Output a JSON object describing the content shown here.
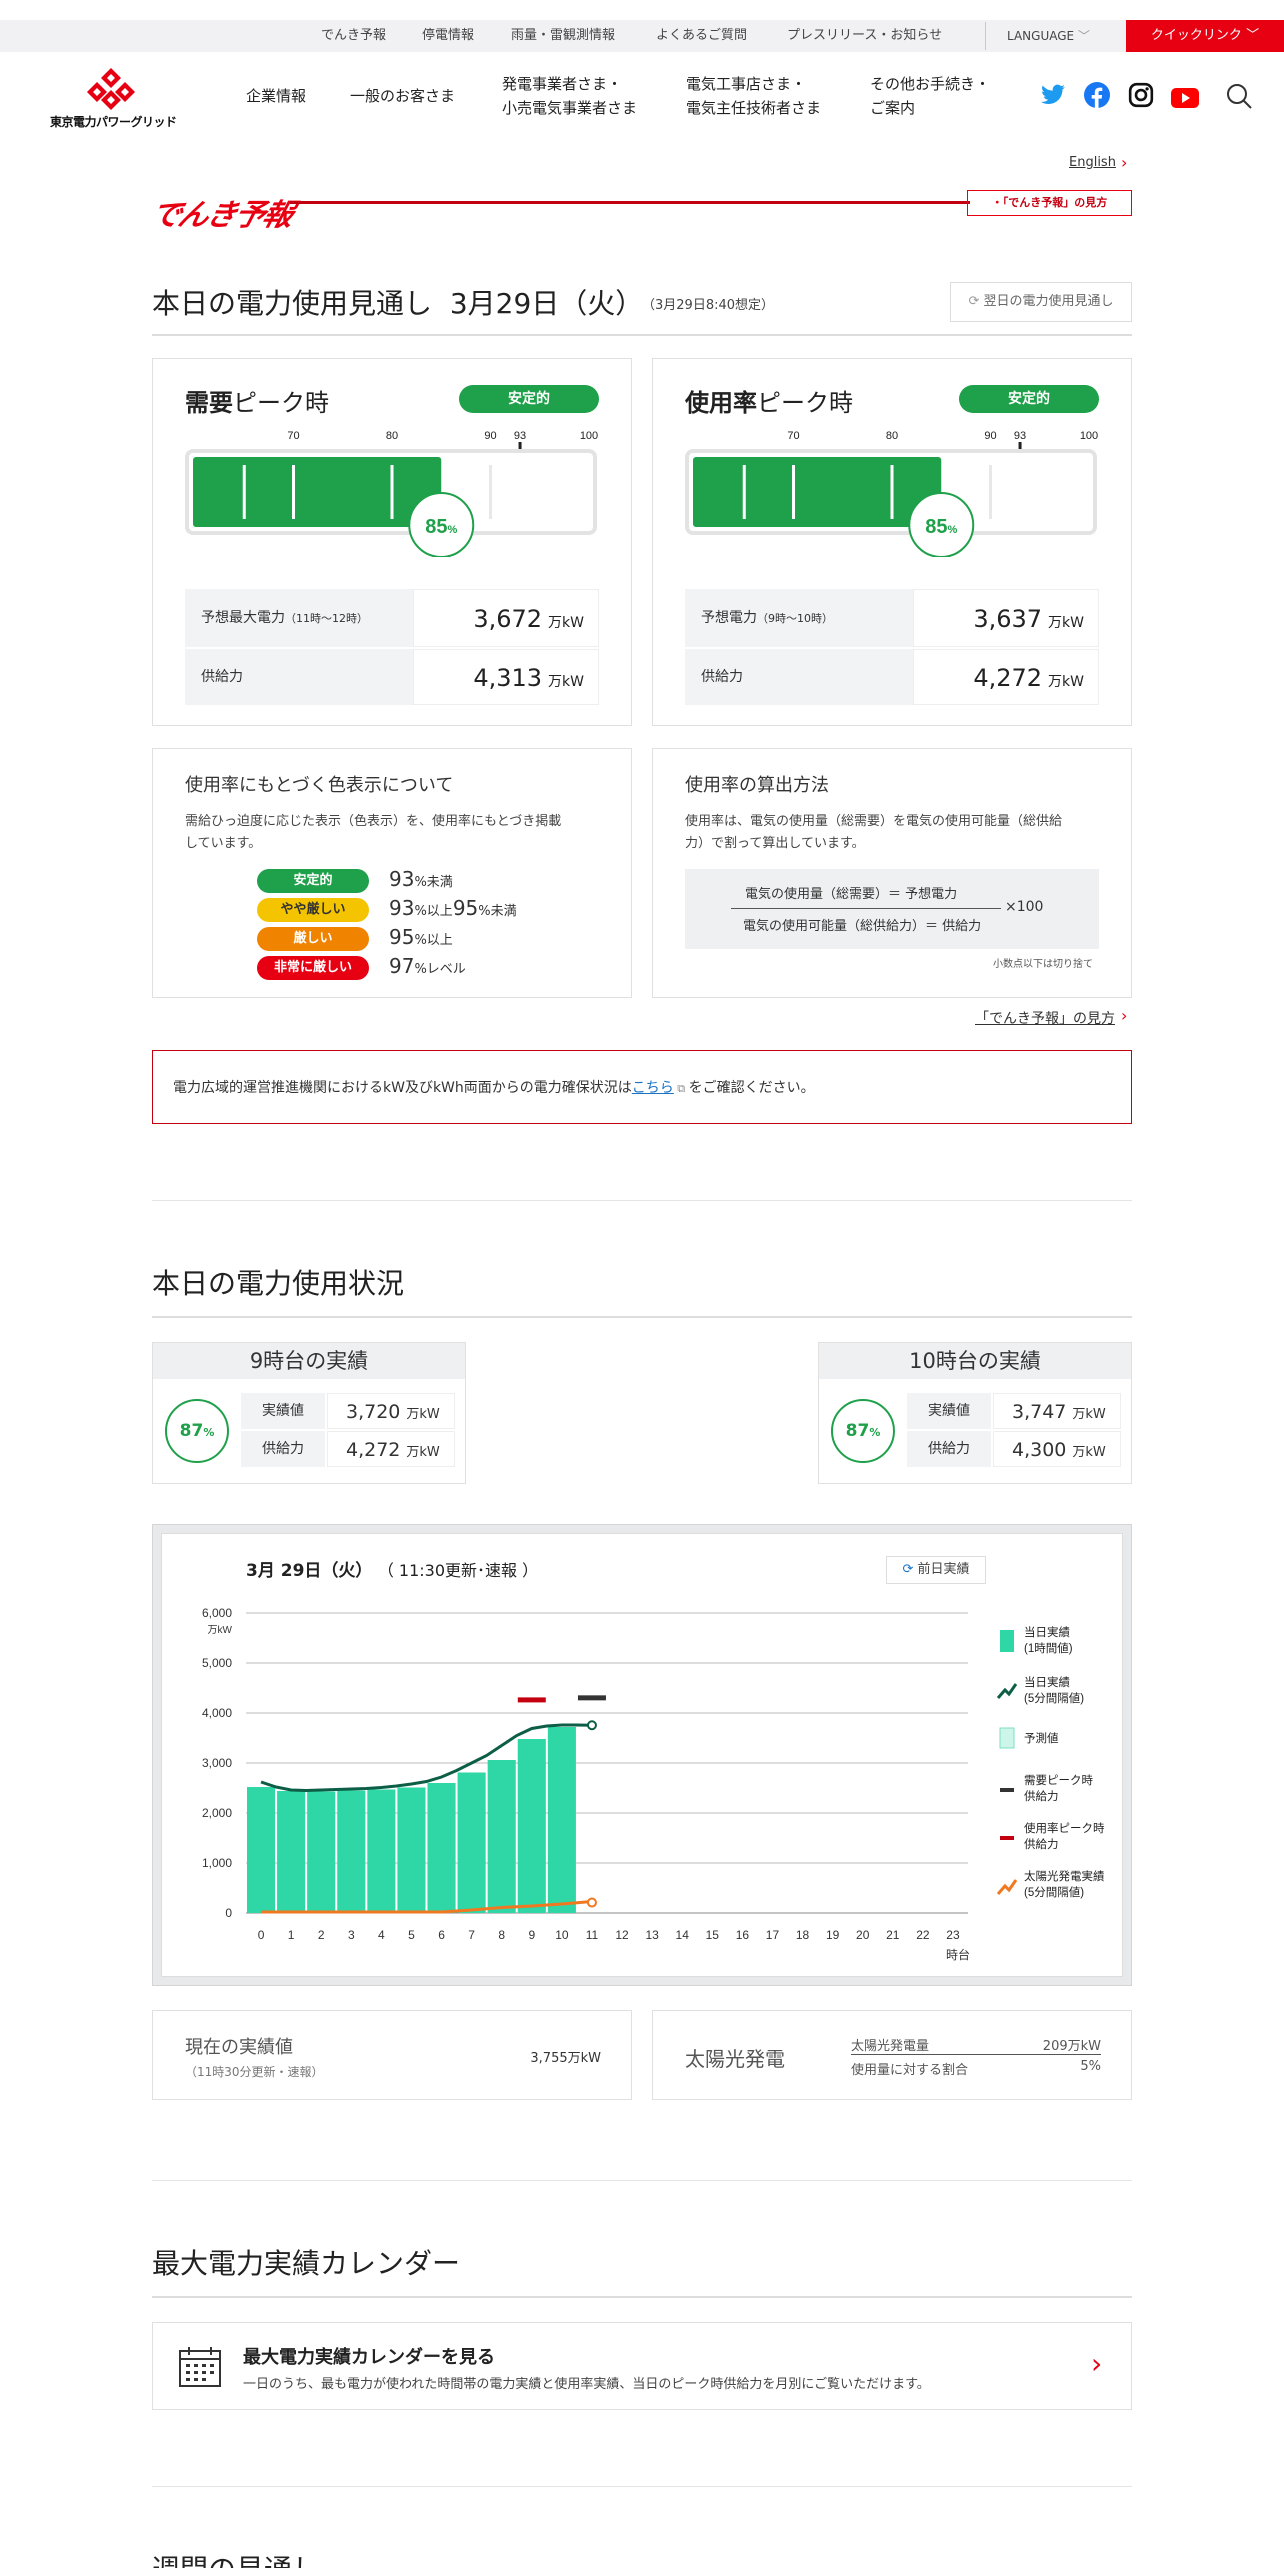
{
  "colors": {
    "brand_red": "#e60012",
    "stable_green": "#1fa04a",
    "caution_yellow": "#f5c400",
    "tight_orange": "#f08300",
    "critical_red": "#e60012",
    "actual_teal": "#2fd6a6",
    "actual_line": "#0d5e46",
    "solar_orange": "#f07820"
  },
  "util_nav": [
    "でんき予報",
    "停電情報",
    "雨量・雷観測情報",
    "よくあるご質問",
    "プレスリリース・お知らせ"
  ],
  "language_label": "LANGUAGE",
  "quicklink_label": "クイックリンク",
  "logo_text": "東京電力パワーグリッド",
  "main_nav": [
    {
      "line1": "企業情報",
      "line2": ""
    },
    {
      "line1": "一般のお客さま",
      "line2": ""
    },
    {
      "line1": "発電事業者さま・",
      "line2": "小売電気事業者さま"
    },
    {
      "line1": "電気工事店さま・",
      "line2": "電気主任技術者さま"
    },
    {
      "line1": "その他お手続き・",
      "line2": "ご案内"
    }
  ],
  "english_link": "English",
  "denki_yoho_logo": "でんき予報",
  "howto_button": "「でんき予報」の見方",
  "forecast": {
    "heading": "本日の電力使用見通し",
    "date": "3月29日（火）",
    "assumed": "（3月29日8:40想定）",
    "next_day_button": "翌日の電力使用見通し",
    "demand_card": {
      "title_bold": "需要",
      "title_rest": "ピーク時",
      "status": "安定的",
      "scale": [
        "70",
        "80",
        "90",
        "93",
        "100"
      ],
      "percent": "85",
      "percent_unit": "%",
      "level": 0.85,
      "rows": [
        {
          "label": "予想最大電力",
          "note": "（11時～12時）",
          "value": "3,672",
          "unit": "万kW"
        },
        {
          "label": "供給力",
          "note": "",
          "value": "4,313",
          "unit": "万kW"
        }
      ]
    },
    "usage_card": {
      "title_bold": "使用率",
      "title_rest": "ピーク時",
      "status": "安定的",
      "scale": [
        "70",
        "80",
        "90",
        "93",
        "100"
      ],
      "percent": "85",
      "percent_unit": "%",
      "level": 0.85,
      "rows": [
        {
          "label": "予想電力",
          "note": "（9時～10時）",
          "value": "3,637",
          "unit": "万kW"
        },
        {
          "label": "供給力",
          "note": "",
          "value": "4,272",
          "unit": "万kW"
        }
      ]
    }
  },
  "color_legend": {
    "title": "使用率にもとづく色表示について",
    "desc1": "需給ひっ迫度に応じた表示（色表示）を、使用率にもとづき掲載",
    "desc2": "しています。",
    "items": [
      {
        "badge": "安定的",
        "n1": "93",
        "t1": "%未満",
        "n2": "",
        "t2": ""
      },
      {
        "badge": "やや厳しい",
        "n1": "93",
        "t1": "%以上",
        "n2": "95",
        "t2": "%未満"
      },
      {
        "badge": "厳しい",
        "n1": "95",
        "t1": "%以上",
        "n2": "",
        "t2": ""
      },
      {
        "badge": "非常に厳しい",
        "n1": "97",
        "t1": "%レベル",
        "n2": "",
        "t2": ""
      }
    ]
  },
  "calc_method": {
    "title": "使用率の算出方法",
    "desc1": "使用率は、電気の使用量（総需要）を電気の使用可能量（総供給",
    "desc2": "力）で割って算出しています。",
    "numerator": "電気の使用量（総需要）＝ 予想電力",
    "denominator": "電気の使用可能量（総供給力）＝ 供給力",
    "times": "×100",
    "note": "小数点以下は切り捨て"
  },
  "howto_link": "「でんき予報」の見方",
  "notice": {
    "pre": "電力広域的運営推進機関におけるkW及びkWh両面からの電力確保状況は",
    "link": "こちら",
    "post": "をご確認ください。"
  },
  "today_usage": {
    "heading": "本日の電力使用状況",
    "blocks": [
      {
        "title_num": "9時台",
        "title_rest": "の実績",
        "percent": "87",
        "actual_label": "実績値",
        "actual": "3,720",
        "supply_label": "供給力",
        "supply": "4,272",
        "unit": "万kW"
      },
      {
        "title_num": "10時台",
        "title_rest": "の実績",
        "percent": "87",
        "actual_label": "実績値",
        "actual": "3,747",
        "supply_label": "供給力",
        "supply": "4,300",
        "unit": "万kW"
      }
    ]
  },
  "chart_title": {
    "date": "3月 29日（火）",
    "update": "（ 11:30更新･速報 ）",
    "prev_button": "前日実績"
  },
  "chart_data": {
    "type": "bar",
    "ylabel": "万kW",
    "xlabel": "時台",
    "ylim": [
      0,
      6000
    ],
    "yticks": [
      "0",
      "1,000",
      "2,000",
      "3,000",
      "4,000",
      "5,000",
      "6,000"
    ],
    "categories": [
      "0",
      "1",
      "2",
      "3",
      "4",
      "5",
      "6",
      "7",
      "8",
      "9",
      "10",
      "11",
      "12",
      "13",
      "14",
      "15",
      "16",
      "17",
      "18",
      "19",
      "20",
      "21",
      "22",
      "23"
    ],
    "series": [
      {
        "name": "当日実績(1時間値)",
        "values": [
          2520,
          2440,
          2430,
          2450,
          2470,
          2510,
          2600,
          2810,
          3060,
          3480,
          3720,
          3747
        ]
      },
      {
        "name": "当日実績(5分間隔値)",
        "x": [
          0,
          0.5,
          1,
          1.5,
          2,
          2.5,
          3,
          3.5,
          4,
          4.5,
          5,
          5.5,
          6,
          6.5,
          7,
          7.5,
          8,
          8.5,
          9,
          9.5,
          10,
          10.5,
          11
        ],
        "values": [
          2620,
          2520,
          2460,
          2450,
          2460,
          2470,
          2480,
          2490,
          2510,
          2540,
          2580,
          2630,
          2720,
          2850,
          3000,
          3150,
          3350,
          3550,
          3690,
          3740,
          3760,
          3760,
          3755
        ]
      },
      {
        "name": "太陽光発電実績(5分間隔値)",
        "x": [
          0,
          6,
          7,
          8,
          9,
          10,
          11
        ],
        "values": [
          0,
          0,
          40,
          90,
          120,
          160,
          209
        ]
      },
      {
        "name": "需要ピーク時供給力",
        "x": [
          11
        ],
        "values": [
          4313
        ]
      },
      {
        "name": "使用率ピーク時供給力",
        "x": [
          9
        ],
        "values": [
          4272
        ]
      }
    ],
    "legend": [
      "当日実績",
      "(1時間値)",
      "当日実績",
      "(5分間隔値)",
      "予測値",
      "需要ピーク時",
      "供給力",
      "使用率ピーク時",
      "供給力",
      "太陽光発電実績",
      "(5分間隔値)"
    ],
    "legend_position": "right",
    "grid": true
  },
  "current": {
    "title": "現在の実績値",
    "sub": "（11時30分更新・速報）",
    "value": "3,755万kW"
  },
  "solar": {
    "title": "太陽光発電",
    "r1_label": "太陽光発電量",
    "r1_value": "209万kW",
    "r2_label": "使用量に対する割合",
    "r2_value": "5%"
  },
  "calendar": {
    "heading": "最大電力実績カレンダー",
    "link_title": "最大電力実績カレンダーを見る",
    "link_desc": "一日のうち、最も電力が使われた時間帯の電力実績と使用率実績、当日のピーク時供給力を月別にご覧いただけます。"
  },
  "weekly_heading": "週間の見通し"
}
